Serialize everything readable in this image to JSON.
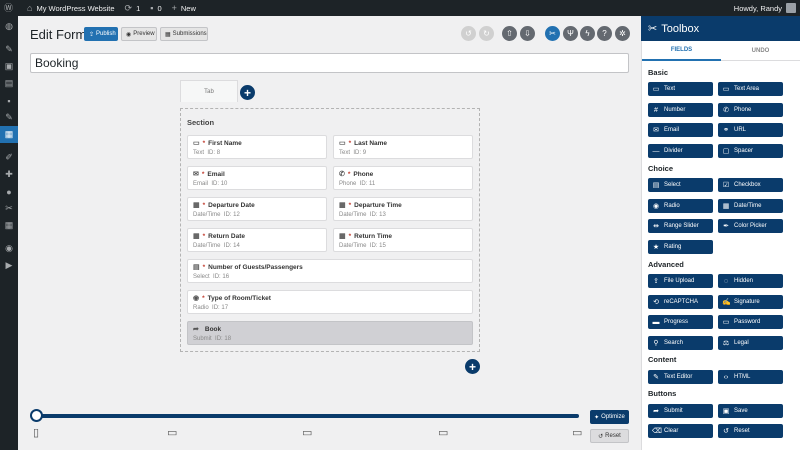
{
  "admin_bar": {
    "site_name": "My WordPress Website",
    "updates_count": "1",
    "comments_count": "0",
    "new_label": "New",
    "howdy": "Howdy, Randy"
  },
  "side_menu": {
    "items": [
      "dashboard-icon",
      "pin-icon",
      "media-icon",
      "pages-icon",
      "comments-icon",
      "pin-icon",
      "forms-icon",
      "appearance-icon",
      "plugins-icon",
      "users-icon",
      "tools-icon",
      "settings-icon",
      "plugin-circle-icon",
      "play-icon"
    ]
  },
  "header": {
    "title": "Edit Form",
    "publish_label": "Publish",
    "preview_label": "Preview",
    "submissions_label": "Submissions"
  },
  "form": {
    "name": "Booking",
    "tab_label": "Tab",
    "section_title": "Section",
    "fields": [
      {
        "label": "First Name",
        "required": "*",
        "type": "Text",
        "id": "ID: 8",
        "icon": "text-field-icon"
      },
      {
        "label": "Last Name",
        "required": "*",
        "type": "Text",
        "id": "ID: 9",
        "icon": "text-field-icon"
      },
      {
        "label": "Email",
        "required": "*",
        "type": "Email",
        "id": "ID: 10",
        "icon": "envelope-icon"
      },
      {
        "label": "Phone",
        "required": "*",
        "type": "Phone",
        "id": "ID: 11",
        "icon": "phone-icon"
      },
      {
        "label": "Departure Date",
        "required": "*",
        "type": "Date/Time",
        "id": "ID: 12",
        "icon": "calendar-icon"
      },
      {
        "label": "Departure Time",
        "required": "*",
        "type": "Date/Time",
        "id": "ID: 13",
        "icon": "calendar-icon"
      },
      {
        "label": "Return Date",
        "required": "*",
        "type": "Date/Time",
        "id": "ID: 14",
        "icon": "calendar-icon"
      },
      {
        "label": "Return Time",
        "required": "*",
        "type": "Date/Time",
        "id": "ID: 15",
        "icon": "calendar-icon"
      },
      {
        "label": "Number of Guests/Passengers",
        "required": "*",
        "type": "Select",
        "id": "ID: 16",
        "icon": "select-icon"
      },
      {
        "label": "Type of Room/Ticket",
        "required": "*",
        "type": "Radio",
        "id": "ID: 17",
        "icon": "radio-icon"
      },
      {
        "label": "Book",
        "required": "",
        "type": "Submit",
        "id": "ID: 18",
        "icon": "share-arrow-icon"
      }
    ]
  },
  "bottom": {
    "optimize_label": "Optimize",
    "reset_label": "Reset",
    "devices": [
      "mobile-icon",
      "tablet-icon",
      "laptop-icon",
      "desktop-icon",
      "monitor-icon"
    ]
  },
  "toolbox": {
    "title": "Toolbox",
    "tab_fields": "FIELDS",
    "tab_undo": "UNDO",
    "groups": [
      {
        "name": "Basic",
        "items": [
          {
            "label": "Text",
            "icon": "text-field-icon"
          },
          {
            "label": "Text Area",
            "icon": "textarea-icon"
          },
          {
            "label": "Number",
            "icon": "hash-icon"
          },
          {
            "label": "Phone",
            "icon": "phone-icon"
          },
          {
            "label": "Email",
            "icon": "envelope-icon"
          },
          {
            "label": "URL",
            "icon": "link-icon"
          },
          {
            "label": "Divider",
            "icon": "divider-icon"
          },
          {
            "label": "Spacer",
            "icon": "spacer-icon"
          }
        ]
      },
      {
        "name": "Choice",
        "items": [
          {
            "label": "Select",
            "icon": "select-icon"
          },
          {
            "label": "Checkbox",
            "icon": "checkbox-icon"
          },
          {
            "label": "Radio",
            "icon": "radio-icon"
          },
          {
            "label": "Date/Time",
            "icon": "calendar-icon"
          },
          {
            "label": "Range Slider",
            "icon": "slider-icon"
          },
          {
            "label": "Color Picker",
            "icon": "eyedropper-icon"
          },
          {
            "label": "Rating",
            "icon": "star-icon"
          }
        ]
      },
      {
        "name": "Advanced",
        "items": [
          {
            "label": "File Upload",
            "icon": "upload-icon"
          },
          {
            "label": "Hidden",
            "icon": "eye-slash-icon"
          },
          {
            "label": "reCAPTCHA",
            "icon": "recaptcha-icon"
          },
          {
            "label": "Signature",
            "icon": "signature-icon"
          },
          {
            "label": "Progress",
            "icon": "progress-icon"
          },
          {
            "label": "Password",
            "icon": "password-icon"
          },
          {
            "label": "Search",
            "icon": "search-icon"
          },
          {
            "label": "Legal",
            "icon": "legal-icon"
          }
        ]
      },
      {
        "name": "Content",
        "items": [
          {
            "label": "Text Editor",
            "icon": "pencil-icon"
          },
          {
            "label": "HTML",
            "icon": "code-icon"
          }
        ]
      },
      {
        "name": "Buttons",
        "items": [
          {
            "label": "Submit",
            "icon": "share-arrow-icon"
          },
          {
            "label": "Save",
            "icon": "save-icon"
          },
          {
            "label": "Clear",
            "icon": "eraser-icon"
          },
          {
            "label": "Reset",
            "icon": "reset-icon"
          }
        ]
      }
    ]
  },
  "colors": {
    "brand": "#0a3b6b",
    "accent": "#2271b1",
    "required": "#c0392b"
  }
}
